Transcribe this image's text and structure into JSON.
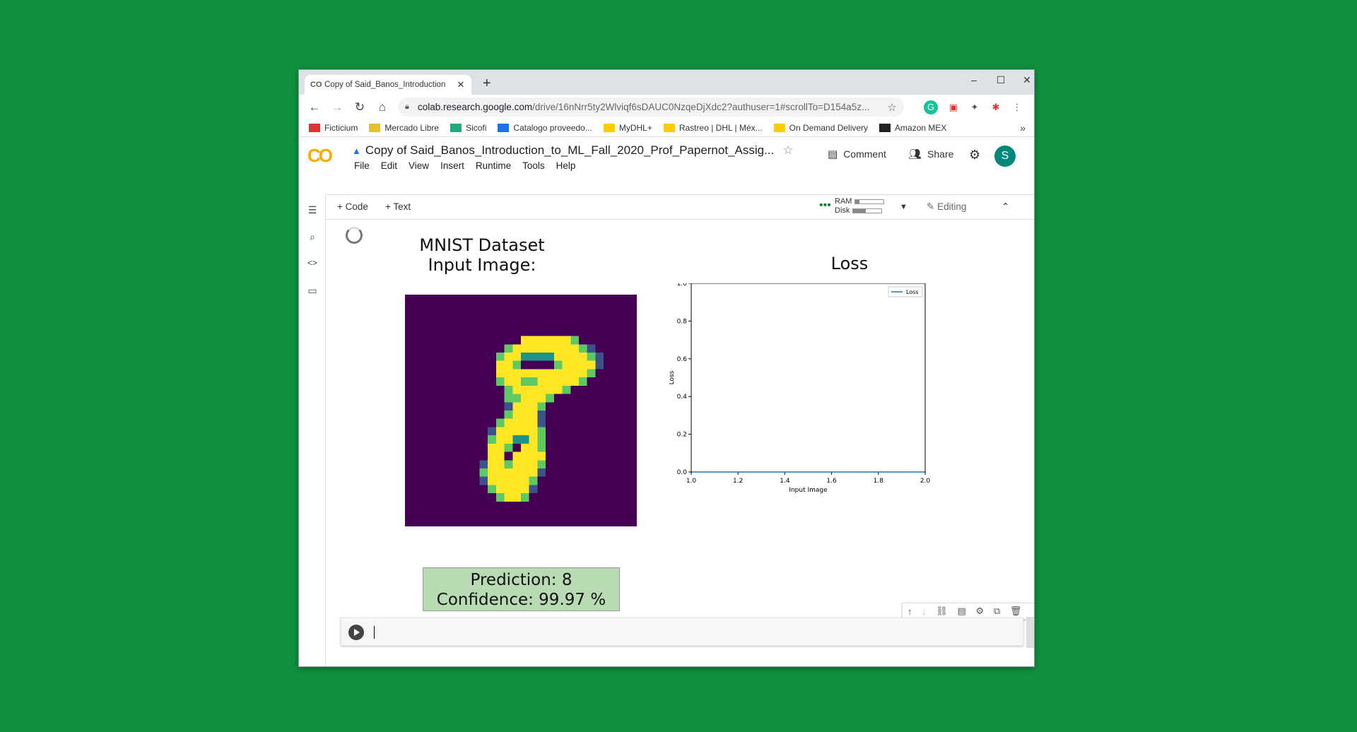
{
  "browser": {
    "tab_title": "Copy of Said_Banos_Introduction",
    "tab_fav": "CO",
    "url_host": "colab.research.google.com",
    "url_path": "/drive/16nNrr5ty2Wlviqf6sDAUC0NzqeDjXdc2?authuser=1#scrollTo=D154a5z...",
    "bookmarks": [
      {
        "label": "Ficticium",
        "icon": "ficticium-icon",
        "color": "#d33"
      },
      {
        "label": "Mercado Libre",
        "icon": "mercadolibre-icon",
        "color": "#e2c233"
      },
      {
        "label": "Sicofi",
        "icon": "sicofi-icon",
        "color": "#2a7"
      },
      {
        "label": "Catalogo proveedo...",
        "icon": "google-drive-icon",
        "color": "#1a73e8"
      },
      {
        "label": "MyDHL+",
        "icon": "dhl-icon",
        "color": "#ffcc00"
      },
      {
        "label": "Rastreo | DHL | Méx...",
        "icon": "dhl-icon",
        "color": "#ffcc00"
      },
      {
        "label": "On Demand Delivery",
        "icon": "dhl-icon",
        "color": "#ffcc00"
      },
      {
        "label": "Amazon MEX",
        "icon": "amazon-icon",
        "color": "#222"
      }
    ]
  },
  "colab": {
    "logo": "CO",
    "doc_title": "Copy of Said_Banos_Introduction_to_ML_Fall_2020_Prof_Papernot_Assig...",
    "menu": [
      "File",
      "Edit",
      "View",
      "Insert",
      "Runtime",
      "Tools",
      "Help"
    ],
    "comment_label": "Comment",
    "share_label": "Share",
    "avatar_letter": "S",
    "add_code": "+ Code",
    "add_text": "+ Text",
    "ram_label": "RAM",
    "disk_label": "Disk",
    "ram_fraction": 0.15,
    "disk_fraction": 0.45,
    "editing_label": "Editing"
  },
  "output": {
    "mnist_title_line1": "MNIST Dataset",
    "mnist_title_line2": "Input Image:",
    "prediction_line": "Prediction: 8",
    "confidence_line": "Confidence: 99.97 %"
  },
  "chart_data": {
    "type": "line",
    "title": "Loss",
    "xlabel": "Input Image",
    "ylabel": "Loss",
    "xlim": [
      1.0,
      2.0
    ],
    "ylim": [
      0.0,
      1.0
    ],
    "xticks": [
      "1.0",
      "1.2",
      "1.4",
      "1.6",
      "1.8",
      "2.0"
    ],
    "yticks": [
      "0.0",
      "0.2",
      "0.4",
      "0.6",
      "0.8",
      "1.0"
    ],
    "legend_position": "top-right",
    "series": [
      {
        "name": "Loss",
        "x": [
          1.0,
          2.0
        ],
        "y": [
          0.0,
          0.0
        ],
        "color": "#1f77b4"
      }
    ]
  }
}
